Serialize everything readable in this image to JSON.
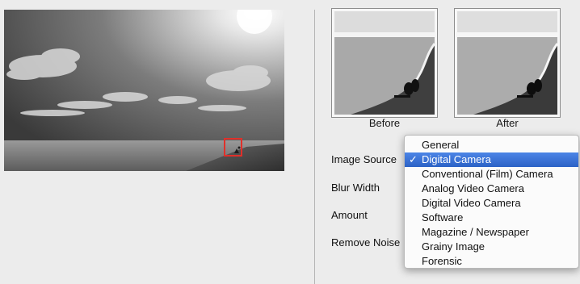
{
  "thumbnails": {
    "before_label": "Before",
    "after_label": "After"
  },
  "form": {
    "image_source_label": "Image Source",
    "blur_width_label": "Blur Width",
    "amount_label": "Amount",
    "remove_noise_label": "Remove Noise"
  },
  "image_source_menu": {
    "selected": "Digital Camera",
    "checkmark": "✓",
    "items": [
      "General",
      "Digital Camera",
      "Conventional (Film) Camera",
      "Analog Video Camera",
      "Digital Video Camera",
      "Software",
      "Magazine / Newspaper",
      "Grainy Image",
      "Forensic"
    ]
  },
  "colors": {
    "selection_box": "#e0302a",
    "menu_highlight": "#3a72d6"
  }
}
